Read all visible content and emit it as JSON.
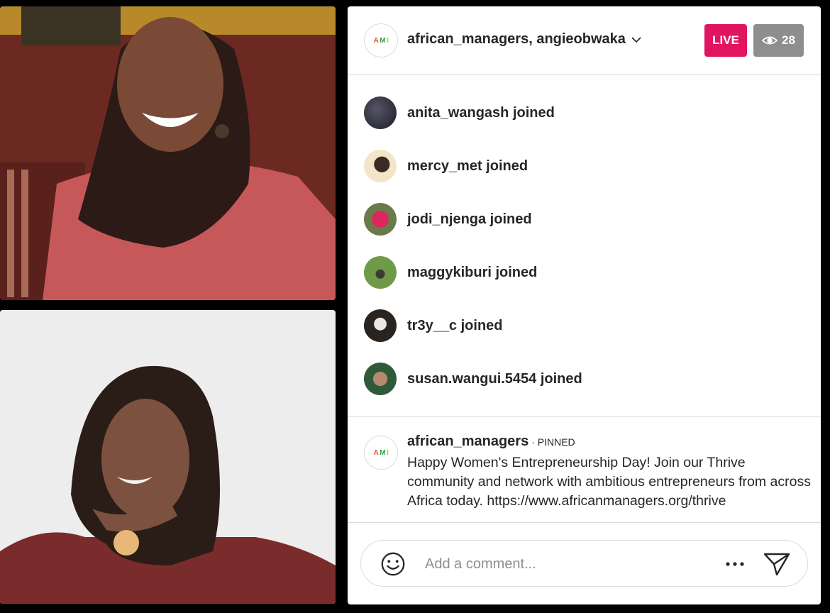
{
  "header": {
    "title": "african_managers, angieobwaka",
    "live_label": "LIVE",
    "viewer_count": "28",
    "logo_text": "AMI",
    "live_color": "#e0145f"
  },
  "joins": [
    {
      "name": "anita_wangash",
      "suffix": " joined"
    },
    {
      "name": "mercy_met",
      "suffix": " joined"
    },
    {
      "name": "jodi_njenga",
      "suffix": " joined"
    },
    {
      "name": "maggykiburi",
      "suffix": " joined"
    },
    {
      "name": "tr3y__c",
      "suffix": " joined"
    },
    {
      "name": "susan.wangui.5454",
      "suffix": " joined"
    }
  ],
  "pinned": {
    "user": "african_managers",
    "tag": "· PINNED",
    "message": "Happy Women's Entrepreneurship Day! Join our Thrive community and network with ambitious entrepreneurs from across Africa today. https://www.africanmanagers.org/thrive"
  },
  "composer": {
    "placeholder": "Add a comment..."
  }
}
